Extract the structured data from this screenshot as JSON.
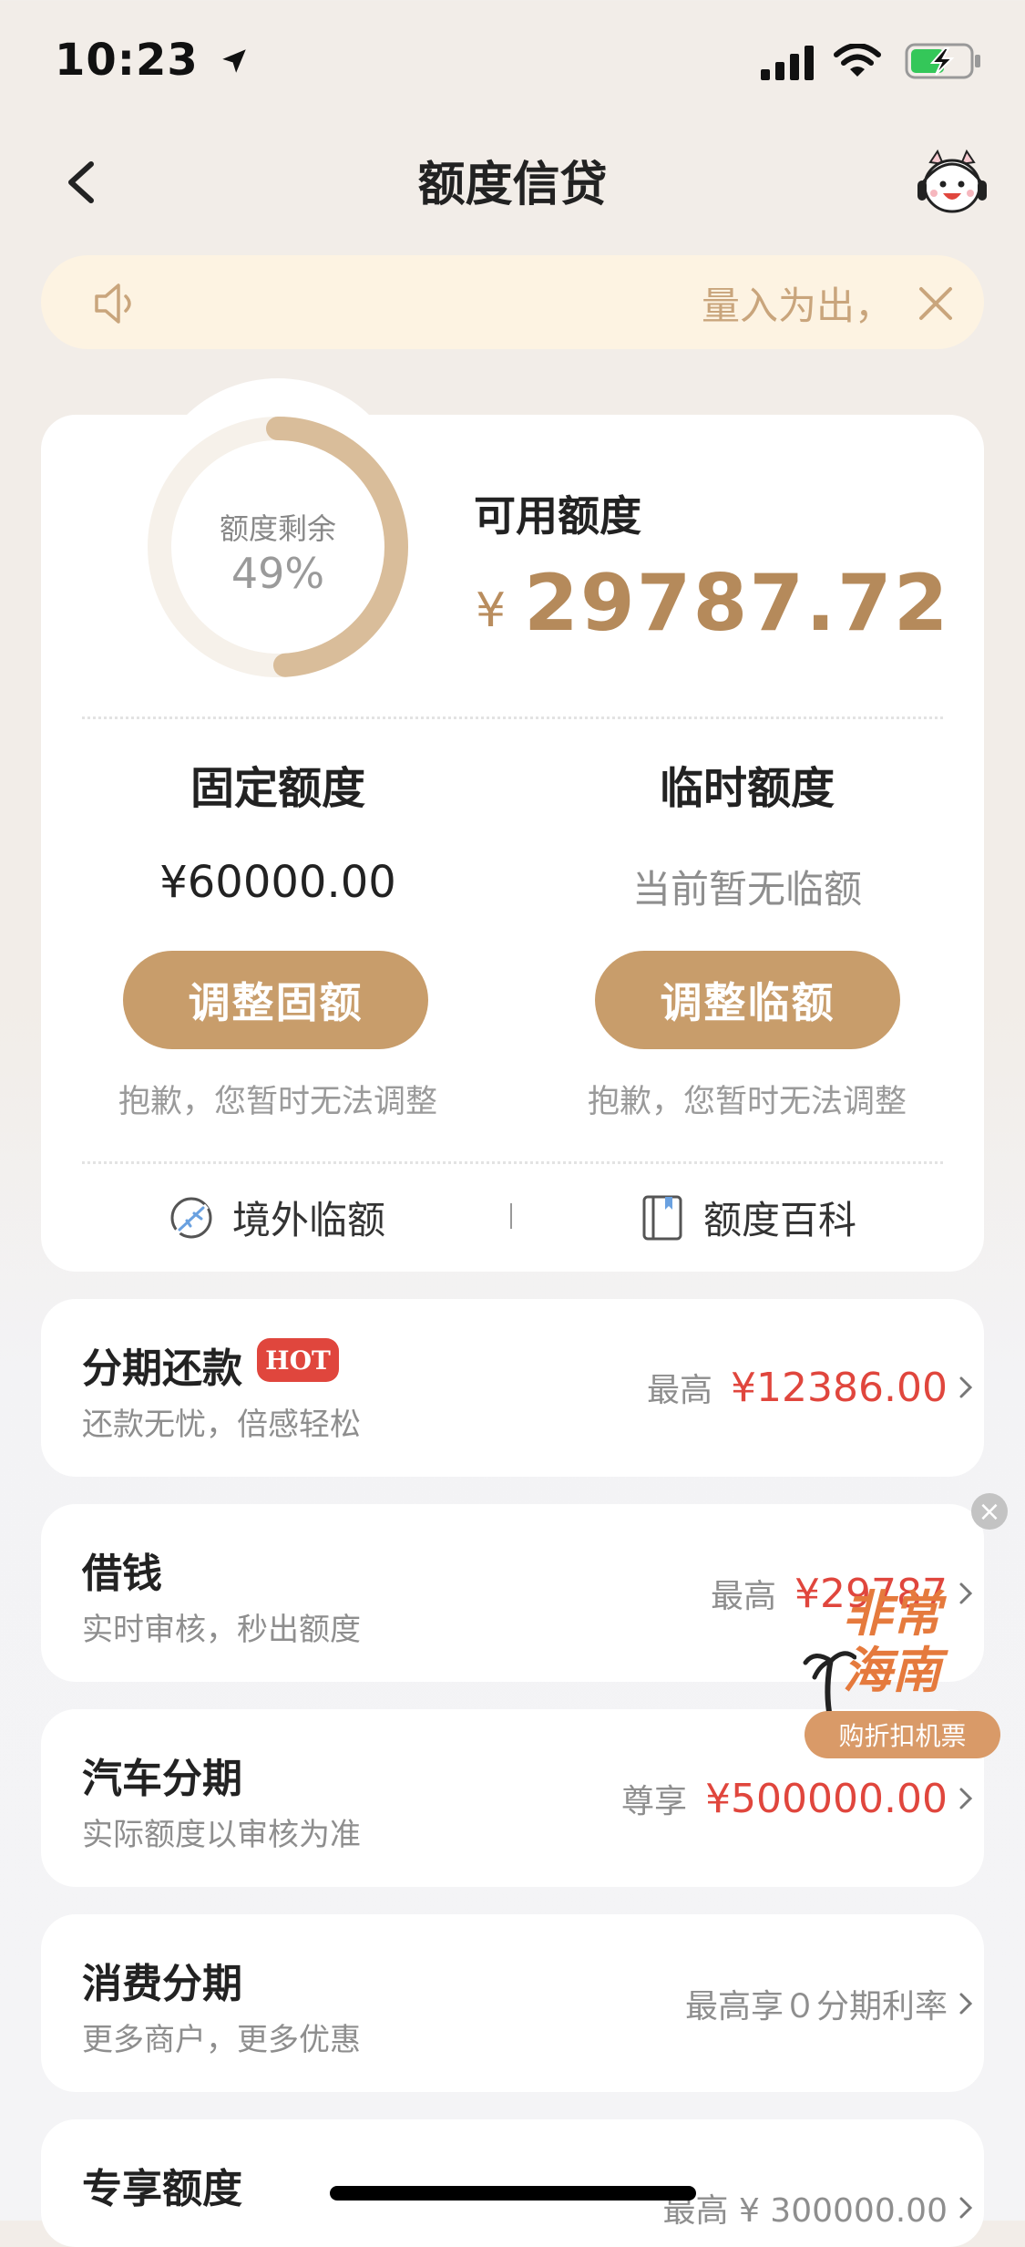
{
  "status_bar": {
    "time": "10:23"
  },
  "nav": {
    "title": "额度信贷"
  },
  "notice": {
    "text": "量入为出，"
  },
  "credit": {
    "ring_label": "额度剩余",
    "ring_value": "49%",
    "ring_fraction": 0.49,
    "available_label": "可用额度",
    "currency": "¥",
    "available_amount": "29787.72",
    "fixed": {
      "title": "固定额度",
      "value": "¥60000.00",
      "button": "调整固额",
      "note": "抱歉，您暂时无法调整"
    },
    "temp": {
      "title": "临时额度",
      "value": "当前暂无临额",
      "button": "调整临额",
      "note": "抱歉，您暂时无法调整"
    },
    "links": {
      "overseas": "境外临额",
      "wiki": "额度百科"
    }
  },
  "list": [
    {
      "title": "分期还款",
      "badge": "HOT",
      "subtitle": "还款无忧，倍感轻松",
      "prefix": "最高",
      "amount": "¥12386.00"
    },
    {
      "title": "借钱",
      "subtitle": "实时审核，秒出额度",
      "prefix": "最高",
      "amount": "¥29787"
    },
    {
      "title": "汽车分期",
      "subtitle": "实际额度以审核为准",
      "prefix": "尊享",
      "amount": "¥500000.00"
    },
    {
      "title": "消费分期",
      "subtitle": "更多商户，更多优惠",
      "plain": "最高享０分期利率"
    },
    {
      "title": "专享额度",
      "plain": "最高 ¥ 300000.00"
    }
  ],
  "ad": {
    "line1": "非常",
    "line2": "海南",
    "button": "购折扣机票"
  },
  "colors": {
    "accent": "#c89d6b",
    "amount_red": "#e0463d",
    "notice_bg": "#fdf3e2"
  }
}
